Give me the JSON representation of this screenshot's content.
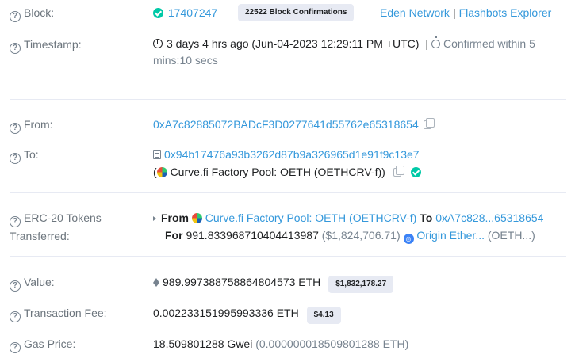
{
  "block": {
    "label": "Block:",
    "number": "17407247",
    "confirmations": "22522 Block Confirmations",
    "builder_link": "Eden Network",
    "separator": "|",
    "explorer_link": "Flashbots Explorer"
  },
  "timestamp": {
    "label": "Timestamp:",
    "value": "3 days 4 hrs ago (Jun-04-2023 12:29:11 PM +UTC)",
    "separator": "|",
    "confirmed": "Confirmed within 5 mins:10 secs"
  },
  "from": {
    "label": "From:",
    "address": "0xA7c82885072BADcF3D0277641d55762e65318654"
  },
  "to": {
    "label": "To:",
    "address": "0x94b17476a93b3262d87b9a326965d1e91f9c13e7",
    "open_paren": "(",
    "name": "Curve.fi Factory Pool: OETH (OETHCRV-f)",
    "close_paren": ")"
  },
  "tokens": {
    "label_line1": "ERC-20 Tokens",
    "label_line2": "Transferred:",
    "from_word": "From",
    "from_name": "Curve.fi Factory Pool: OETH (OETHCRV-f)",
    "to_word": "To",
    "to_address": "0xA7c828...65318654",
    "for_word": "For",
    "amount": "991.833968710404413987",
    "usd": "($1,824,706.71)",
    "token_name": "Origin Ether...",
    "token_symbol": "(OETH...)"
  },
  "value": {
    "label": "Value:",
    "amount": "989.997388758864804573 ETH",
    "usd_badge": "$1,832,178.27"
  },
  "fee": {
    "label": "Transaction Fee:",
    "amount": "0.002233151995993336 ETH",
    "usd_badge": "$4.13"
  },
  "gas": {
    "label": "Gas Price:",
    "gwei": "18.509801288 Gwei",
    "eth": "(0.000000018509801288 ETH)"
  },
  "icons": {
    "help": "question-circle-icon",
    "check": "check-circle-icon",
    "copy": "copy-icon",
    "clock": "clock-icon",
    "stopwatch": "stopwatch-icon",
    "contract": "file-contract-icon",
    "curve": "curve-token-icon",
    "origin": "origin-token-icon",
    "eth": "ethereum-icon",
    "caret": "caret-right-icon"
  },
  "colors": {
    "link": "#3498db",
    "success": "#00c9a7",
    "label": "#6c757d",
    "badge_bg": "#e7eaf3"
  }
}
